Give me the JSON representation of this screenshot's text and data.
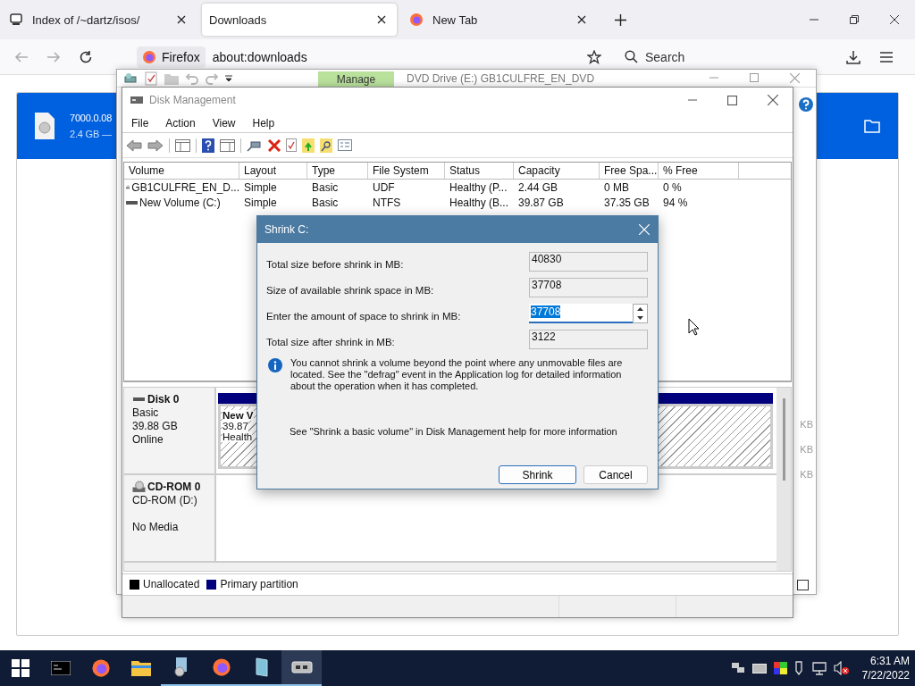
{
  "browser": {
    "tabs": [
      {
        "title": "Index of /~dartz/isos/",
        "selected": false,
        "kind": "page"
      },
      {
        "title": "Downloads",
        "selected": true,
        "kind": "plain"
      },
      {
        "title": "New Tab",
        "selected": false,
        "kind": "firefox"
      }
    ],
    "identity": "Firefox",
    "url": "about:downloads",
    "search_placeholder": "Search",
    "download": {
      "name": "7000.0.08",
      "info": "2.4 GB —"
    }
  },
  "explorer": {
    "ribbon_tab": "Manage",
    "title": "DVD Drive (E:) GB1CULFRE_EN_DVD",
    "size_labels": [
      "KB",
      "KB",
      "KB"
    ]
  },
  "disk_management": {
    "title": "Disk Management",
    "menu": [
      "File",
      "Action",
      "View",
      "Help"
    ],
    "columns": [
      "Volume",
      "Layout",
      "Type",
      "File System",
      "Status",
      "Capacity",
      "Free Spa...",
      "% Free"
    ],
    "rows": [
      {
        "kind": "cd",
        "cells": [
          "GB1CULFRE_EN_D...",
          "Simple",
          "Basic",
          "UDF",
          "Healthy (P...",
          "2.44 GB",
          "0 MB",
          "0 %"
        ]
      },
      {
        "kind": "drive",
        "cells": [
          "New Volume (C:)",
          "Simple",
          "Basic",
          "NTFS",
          "Healthy (B...",
          "39.87 GB",
          "37.35 GB",
          "94 %"
        ]
      }
    ],
    "disks": [
      {
        "kind": "drive",
        "name": "Disk 0",
        "type": "Basic",
        "size": "39.88 GB",
        "status": "Online",
        "partitions": [
          {
            "name": "New V",
            "size": "39.87",
            "status": "Health",
            "selected": true
          }
        ]
      },
      {
        "kind": "cd",
        "name": "CD-ROM 0",
        "type": "CD-ROM (D:)",
        "status": "No Media"
      }
    ],
    "legend": [
      {
        "label": "Unallocated",
        "color": "#000000"
      },
      {
        "label": "Primary partition",
        "color": "#00007f"
      }
    ]
  },
  "dialog": {
    "title": "Shrink C:",
    "fields": [
      {
        "kind": "readonly",
        "label": "Total size before shrink in MB:",
        "value": "40830"
      },
      {
        "kind": "readonly",
        "label": "Size of available shrink space in MB:",
        "value": "37708"
      },
      {
        "kind": "input",
        "label": "Enter the amount of space to shrink in MB:",
        "value": "37708"
      },
      {
        "kind": "readonly",
        "label": "Total size after shrink in MB:",
        "value": "3122"
      }
    ],
    "info": "You cannot shrink a volume beyond the point where any unmovable files are located. See the \"defrag\" event in the Application log for detailed information about the operation when it has completed.",
    "help": "See \"Shrink a basic volume\" in Disk Management help for more information",
    "buttons": [
      {
        "label": "Shrink",
        "default": true
      },
      {
        "label": "Cancel",
        "default": false
      }
    ]
  },
  "taskbar": {
    "items": [
      {
        "kind": "terminal",
        "running": false,
        "selected": false
      },
      {
        "kind": "firefox",
        "running": false,
        "selected": false
      },
      {
        "kind": "folder",
        "running": false,
        "selected": false
      },
      {
        "kind": "setup",
        "running": true,
        "selected": false
      },
      {
        "kind": "firefox",
        "running": true,
        "selected": false
      },
      {
        "kind": "tablet",
        "running": true,
        "selected": false
      },
      {
        "kind": "disk",
        "running": true,
        "selected": true
      }
    ],
    "time": "6:31 AM",
    "date": "7/22/2022"
  }
}
